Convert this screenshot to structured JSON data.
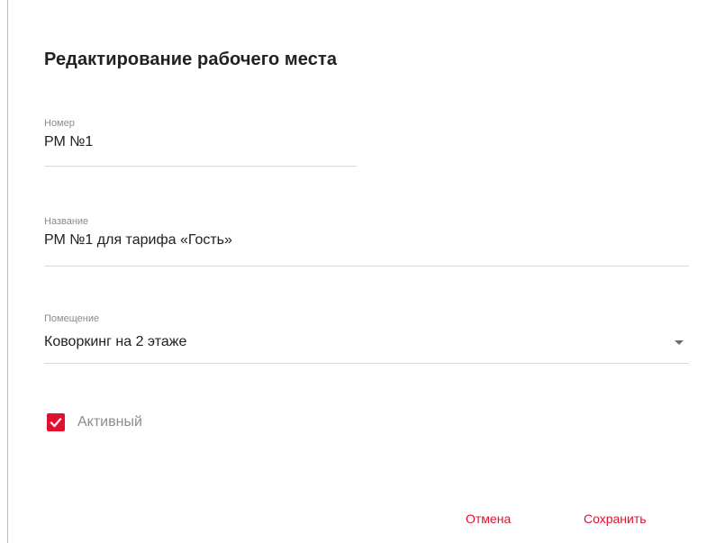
{
  "dialog": {
    "title": "Редактирование рабочего места"
  },
  "fields": {
    "number": {
      "label": "Номер",
      "value": "РМ №1"
    },
    "name": {
      "label": "Название",
      "value": "РМ №1 для тарифа «Гость»"
    },
    "room": {
      "label": "Помещение",
      "value": "Коворкинг на 2 этаже"
    }
  },
  "active_checkbox": {
    "label": "Активный",
    "checked": true
  },
  "actions": {
    "cancel_label": "Отмена",
    "save_label": "Сохранить"
  },
  "colors": {
    "accent": "#e0102e",
    "label": "#8a8a8a",
    "divider": "#d9d9d9"
  },
  "icons": {
    "dropdown": "chevron-down-icon",
    "check": "checkmark-icon"
  }
}
